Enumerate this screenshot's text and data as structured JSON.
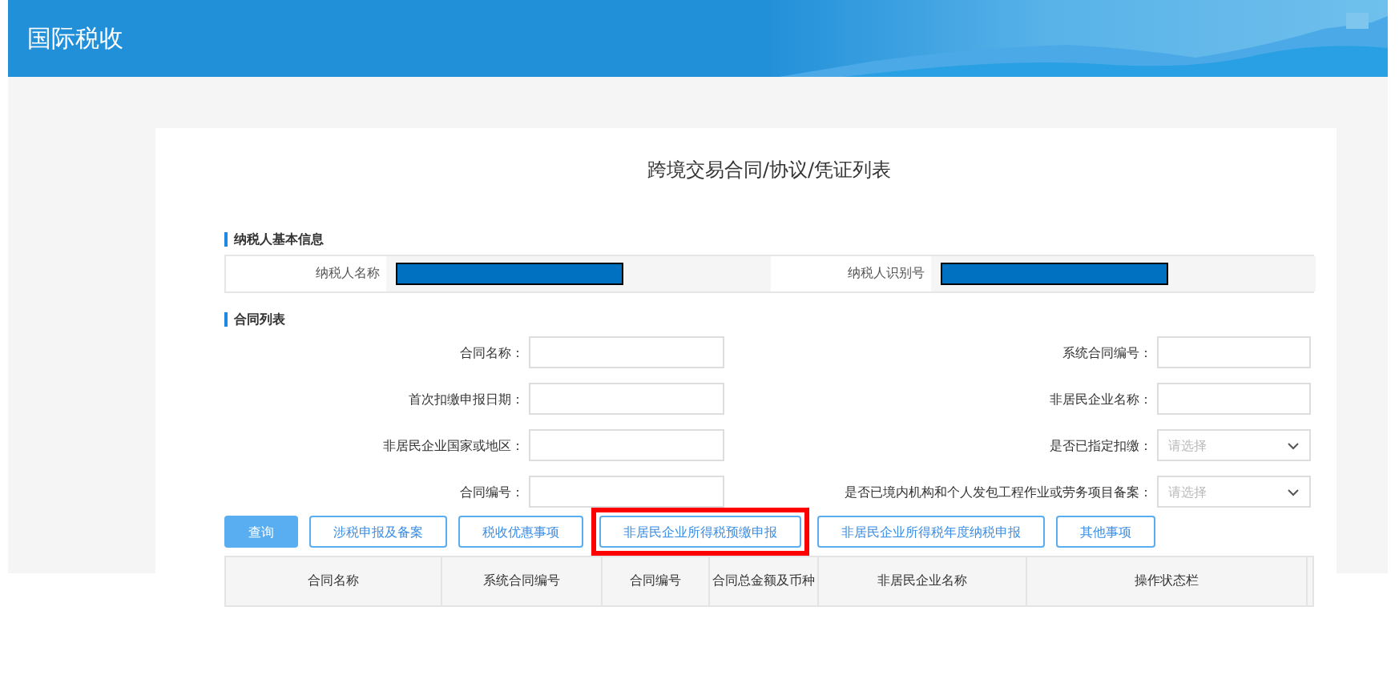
{
  "header": {
    "title": "国际税收"
  },
  "page_title": "跨境交易合同/协议/凭证列表",
  "taxpayer_section": {
    "title": "纳税人基本信息",
    "fields": [
      {
        "label": "纳税人名称"
      },
      {
        "label": "纳税人识别号"
      }
    ]
  },
  "contract_section": {
    "title": "合同列表",
    "filters": [
      {
        "label": "合同名称：",
        "kind": "input"
      },
      {
        "label": "系统合同编号：",
        "kind": "input"
      },
      {
        "label": "首次扣缴申报日期：",
        "kind": "input"
      },
      {
        "label": "非居民企业名称：",
        "kind": "input"
      },
      {
        "label": "非居民企业国家或地区：",
        "kind": "input"
      },
      {
        "label": "是否已指定扣缴：",
        "kind": "select",
        "placeholder": "请选择"
      },
      {
        "label": "合同编号：",
        "kind": "input"
      },
      {
        "label": "是否已境内机构和个人发包工程作业或劳务项目备案：",
        "kind": "select",
        "placeholder": "请选择"
      }
    ],
    "buttons": [
      {
        "label": "查询",
        "kind": "primary",
        "highlighted": false
      },
      {
        "label": "涉税申报及备案",
        "kind": "outline",
        "highlighted": false
      },
      {
        "label": "税收优惠事项",
        "kind": "outline",
        "highlighted": false
      },
      {
        "label": "非居民企业所得税预缴申报",
        "kind": "outline",
        "highlighted": true
      },
      {
        "label": "非居民企业所得税年度纳税申报",
        "kind": "outline",
        "highlighted": false
      },
      {
        "label": "其他事项",
        "kind": "outline",
        "highlighted": false
      }
    ],
    "table": {
      "columns": [
        "合同名称",
        "系统合同编号",
        "合同编号",
        "合同总金额及币种",
        "非居民企业名称",
        "操作状态栏"
      ]
    }
  }
}
